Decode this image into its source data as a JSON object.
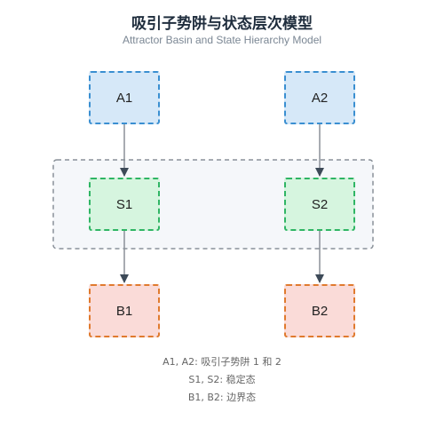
{
  "title": "吸引子势阱与状态层次模型",
  "subtitle": "Attractor Basin and State Hierarchy Model",
  "nodes": {
    "a1": "A1",
    "a2": "A2",
    "s1": "S1",
    "s2": "S2",
    "b1": "B1",
    "b2": "B2"
  },
  "legend": [
    "A1, A2: 吸引子势阱 1 和 2",
    "S1, S2: 稳定态",
    "B1, B2: 边界态"
  ],
  "colors": {
    "attractor_fill": "#d6e8f8",
    "attractor_border": "#3a8fd1",
    "stable_fill": "#d6f5df",
    "stable_border": "#2fb564",
    "boundary_fill": "#fadbd8",
    "boundary_border": "#e07a2e",
    "group_fill": "#f5f7fa",
    "group_border": "#8a9199",
    "arrow": "#3d4a58"
  }
}
